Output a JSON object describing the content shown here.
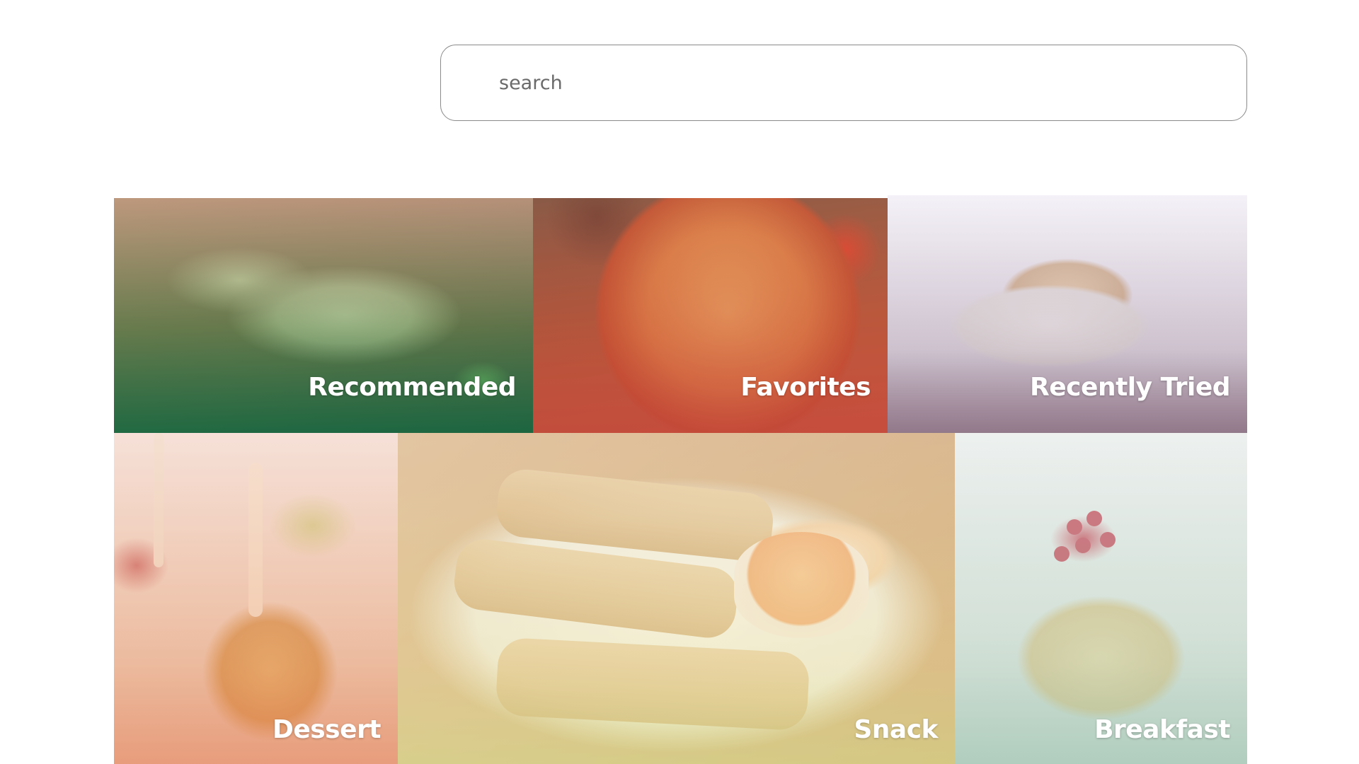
{
  "search": {
    "placeholder": "search"
  },
  "categories": [
    {
      "id": "recommended",
      "label": "Recommended",
      "icon": "burrito-photo"
    },
    {
      "id": "favorites",
      "label": "Favorites",
      "icon": "pizza-photo"
    },
    {
      "id": "recently_tried",
      "label": "Recently Tried",
      "icon": "toast-photo"
    },
    {
      "id": "dessert",
      "label": "Dessert",
      "icon": "caramel-apple-photo"
    },
    {
      "id": "snack",
      "label": "Snack",
      "icon": "spring-rolls-photo"
    },
    {
      "id": "breakfast",
      "label": "Breakfast",
      "icon": "pancakes-photo"
    }
  ],
  "colors": {
    "recommended_tint": "#147046",
    "favorites_tint": "#c84638",
    "recently_tried_tint": "#826478",
    "dessert_tint": "#eb8c64",
    "snack_tint": "#dce696",
    "breakfast_tint": "#a0c8b4"
  }
}
